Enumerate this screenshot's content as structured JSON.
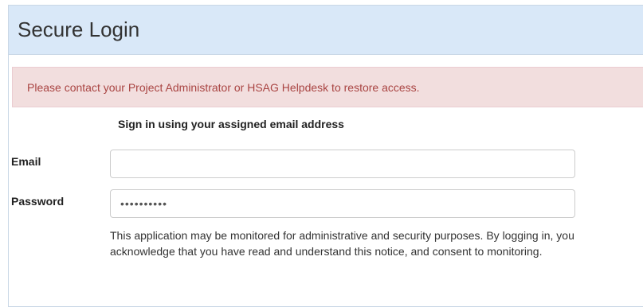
{
  "panel": {
    "title": "Secure Login"
  },
  "alert": {
    "message": "Please contact your Project Administrator or HSAG Helpdesk to restore access."
  },
  "form": {
    "instruction": "Sign in using your assigned email address",
    "email": {
      "label": "Email",
      "value": ""
    },
    "password": {
      "label": "Password",
      "value": "••••••••••"
    },
    "notice": "This application may be monitored for administrative and security purposes. By logging in, you acknowledge that you have read and understand this notice, and consent to monitoring."
  },
  "colors": {
    "header_bg": "#d9e8f8",
    "alert_bg": "#f2dede",
    "alert_text": "#a94442"
  }
}
